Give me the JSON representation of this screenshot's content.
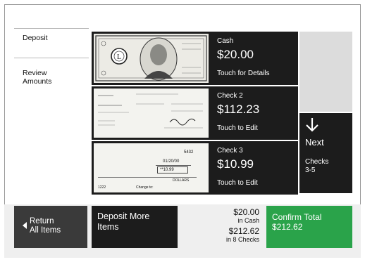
{
  "nav": {
    "items": [
      {
        "label": "Deposit"
      },
      {
        "label": "Review\nAmounts"
      }
    ]
  },
  "items": [
    {
      "label": "Cash",
      "amount": "$20.00",
      "action": "Touch for Details"
    },
    {
      "label": "Check 2",
      "amount": "$112.23",
      "action": "Touch to Edit"
    },
    {
      "label": "Check 3",
      "amount": "$10.99",
      "action": "Touch to Edit"
    }
  ],
  "check3_image": {
    "number": "5432",
    "date": "01/20/00",
    "amount_box": "**10.99",
    "written": "DOLLARS",
    "memo": "Change to:",
    "routing": "1222"
  },
  "next": {
    "label": "Next",
    "sub": "Checks\n3-5"
  },
  "bottom": {
    "return_label": "Return\nAll Items",
    "deposit_more_label": "Deposit More\nItems",
    "cash_total": "$20.00",
    "cash_sub": "in Cash",
    "checks_total": "$212.62",
    "checks_sub": "in 8 Checks",
    "confirm_label": "Confirm Total\n$212.62"
  },
  "colors": {
    "tile": "#1c1c1c",
    "confirm": "#2aa34a",
    "return": "#3a3a3a",
    "gray": "#dcdcdc"
  }
}
